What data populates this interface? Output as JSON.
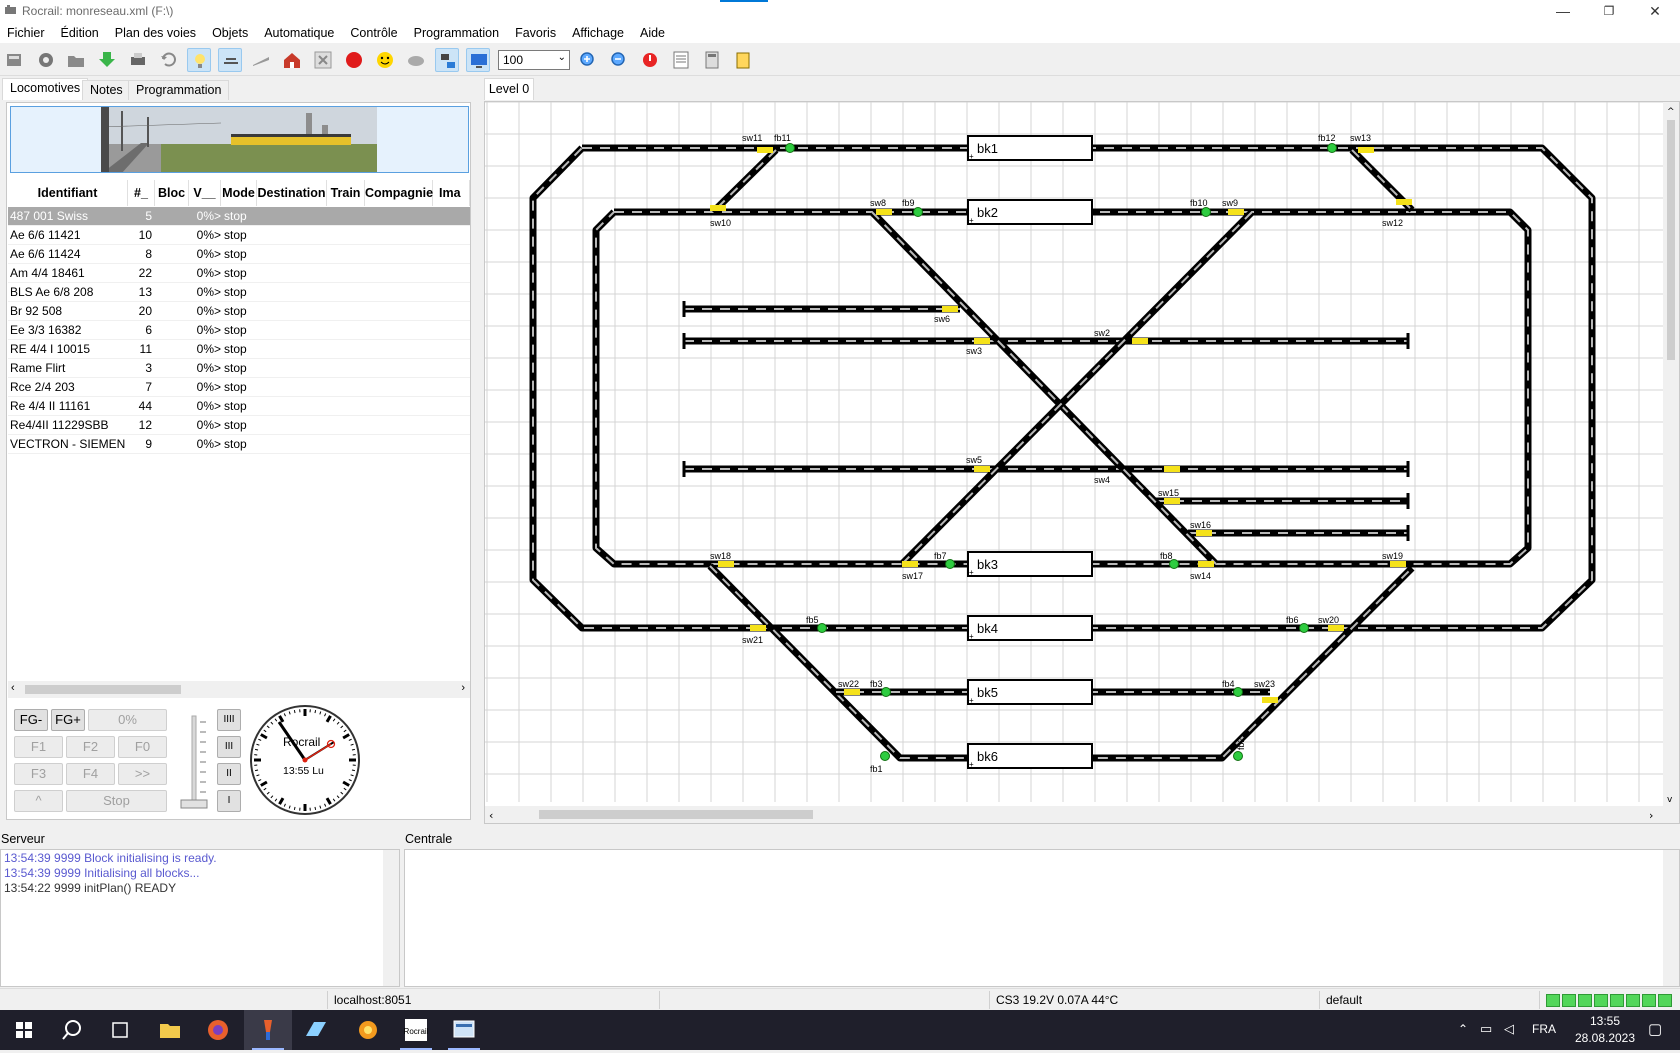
{
  "window": {
    "title": "Rocrail: monreseau.xml (F:\\)",
    "minimize": "—",
    "maximize": "❐",
    "close": "✕"
  },
  "menu": [
    "Fichier",
    "Édition",
    "Plan des voies",
    "Objets",
    "Automatique",
    "Contrôle",
    "Programmation",
    "Favoris",
    "Affichage",
    "Aide"
  ],
  "toolbar": {
    "zoom_value": "100",
    "icons": [
      "server-icon",
      "gear-icon",
      "open-icon",
      "download-icon",
      "print-icon",
      "bulb-icon",
      "route-icon",
      "undo-icon",
      "ramp-icon",
      "house-icon",
      "close-x-icon",
      "stop-icon",
      "smiley-icon",
      "cloud-icon",
      "transfer-icon",
      "monitor-icon",
      "zoom-in-icon",
      "zoom-out-icon",
      "alert-icon",
      "list-icon",
      "calc-icon",
      "notes-icon"
    ]
  },
  "left_tabs": [
    "Locomotives",
    "Notes",
    "Programmation"
  ],
  "loco_table": {
    "columns": [
      "Identifiant",
      "#_",
      "Bloc",
      "V__",
      "Mode",
      "Destination",
      "Train",
      "Compagnie",
      "Ima"
    ],
    "rows": [
      {
        "id": "487 001 Swiss",
        "num": "5",
        "bloc": "",
        "v": "0%>",
        "mode": "stop"
      },
      {
        "id": "Ae 6/6 11421",
        "num": "10",
        "bloc": "",
        "v": "0%>",
        "mode": "stop"
      },
      {
        "id": "Ae 6/6 11424",
        "num": "8",
        "bloc": "",
        "v": "0%>",
        "mode": "stop"
      },
      {
        "id": "Am 4/4 18461",
        "num": "22",
        "bloc": "",
        "v": "0%>",
        "mode": "stop"
      },
      {
        "id": "BLS Ae 6/8 208",
        "num": "13",
        "bloc": "",
        "v": "0%>",
        "mode": "stop"
      },
      {
        "id": "Br 92 508",
        "num": "20",
        "bloc": "",
        "v": "0%>",
        "mode": "stop"
      },
      {
        "id": "Ee 3/3 16382",
        "num": "6",
        "bloc": "",
        "v": "0%>",
        "mode": "stop"
      },
      {
        "id": "RE 4/4 I 10015",
        "num": "11",
        "bloc": "",
        "v": "0%>",
        "mode": "stop"
      },
      {
        "id": "Rame Flirt",
        "num": "3",
        "bloc": "",
        "v": "0%>",
        "mode": "stop"
      },
      {
        "id": "Rce 2/4 203",
        "num": "7",
        "bloc": "",
        "v": "0%>",
        "mode": "stop"
      },
      {
        "id": "Re 4/4 II 11161",
        "num": "44",
        "bloc": "",
        "v": "0%>",
        "mode": "stop"
      },
      {
        "id": "Re4/4II 11229SBB",
        "num": "12",
        "bloc": "",
        "v": "0%>",
        "mode": "stop"
      },
      {
        "id": "VECTRON - SIEMENS",
        "num": "9",
        "bloc": "",
        "v": "0%>",
        "mode": "stop"
      }
    ]
  },
  "throttle": {
    "fg_minus": "FG-",
    "fg_plus": "FG+",
    "speed": "0%",
    "f1": "F1",
    "f2": "F2",
    "f0": "F0",
    "f3": "F3",
    "f4": "F4",
    "more": ">>",
    "up": "^",
    "stop": "Stop",
    "steps": [
      "IIII",
      "III",
      "II",
      "I"
    ],
    "clock_brand": "Rocrail",
    "clock_time": "13:55 Lu"
  },
  "plan": {
    "tab": "Level 0",
    "blocks": [
      "bk1",
      "bk2",
      "bk3",
      "bk4",
      "bk5",
      "bk6"
    ],
    "labels": {
      "sw11": "sw11",
      "fb11": "fb11",
      "fb12": "fb12",
      "sw13": "sw13",
      "sw10": "sw10",
      "sw12": "sw12",
      "sw8": "sw8",
      "fb9": "fb9",
      "fb10": "fb10",
      "sw9": "sw9",
      "sw6": "sw6",
      "sw3": "sw3",
      "sw2": "sw2",
      "sw5": "sw5",
      "sw4": "sw4",
      "sw15": "sw15",
      "sw16": "sw16",
      "sw18": "sw18",
      "fb7": "fb7",
      "sw17": "sw17",
      "fb8": "fb8",
      "sw14": "sw14",
      "sw19": "sw19",
      "fb5a": "fb5",
      "sw21": "sw21",
      "fb6": "fb6",
      "sw20": "sw20",
      "sw22": "sw22",
      "fb3": "fb3",
      "fb4": "fb4",
      "sw23": "sw23",
      "fb1": "fb1",
      "fb2": "fb2"
    }
  },
  "server": {
    "label": "Serveur",
    "lines": [
      {
        "text": "13:54:39 9999 Block initialising is ready.",
        "color": "#5a5ad0"
      },
      {
        "text": "13:54:39 9999 Initialising all blocks...",
        "color": "#5a5ad0"
      },
      {
        "text": "13:54:22 9999 initPlan() READY",
        "color": "#333333"
      }
    ]
  },
  "centrale": {
    "label": "Centrale"
  },
  "status": {
    "host": "localhost:8051",
    "cs": "CS3 19.2V 0.07A 44°C",
    "profile": "default"
  },
  "taskbar": {
    "lang": "FRA",
    "time": "13:55",
    "date": "28.08.2023"
  }
}
